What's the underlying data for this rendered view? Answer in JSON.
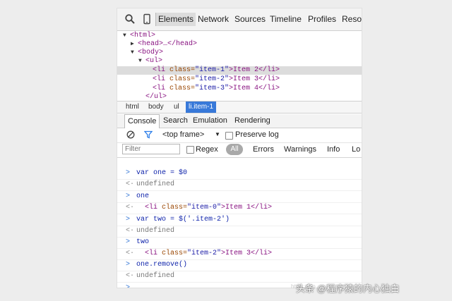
{
  "tabs": {
    "items": [
      "Elements",
      "Network",
      "Sources",
      "Timeline",
      "Profiles",
      "Resou"
    ],
    "active": "Elements"
  },
  "dom_tree": {
    "html_open": "<html>",
    "head": "<head>…</head>",
    "body_open": "<body>",
    "ul_open": "<ul>",
    "li1_open": "<li ",
    "li1_attr": "class=",
    "li1_val": "\"item-1\"",
    "li1_text": ">Item 2</li>",
    "li2_open": "<li ",
    "li2_attr": "class=",
    "li2_val": "\"item-2\"",
    "li2_text": ">Item 3</li>",
    "li3_open": "<li ",
    "li3_attr": "class=",
    "li3_val": "\"item-3\"",
    "li3_text": ">Item 4</li>",
    "ul_close": "</ul>"
  },
  "breadcrumbs": [
    "html",
    "body",
    "ul",
    "li.item-1"
  ],
  "drawer_tabs": [
    "Console",
    "Search",
    "Emulation",
    "Rendering"
  ],
  "toolbar": {
    "frame": "<top frame>",
    "frame_arrow": "▼",
    "preserve_log": "Preserve log"
  },
  "filter": {
    "placeholder": "Filter",
    "regex": "Regex",
    "all": "All",
    "levels": [
      "Errors",
      "Warnings",
      "Info",
      "Lo"
    ]
  },
  "console": {
    "m1": "var one = $0",
    "m2": "undefined",
    "m3": "one",
    "m4_tag": "<li ",
    "m4_attr": "class=",
    "m4_val": "\"item-0\"",
    "m4_text": ">Item 1</li>",
    "m5": "var two = $('.item-2')",
    "m6": "undefined",
    "m7": "two",
    "m8_tag": "<li ",
    "m8_attr": "class=",
    "m8_val": "\"item-2\"",
    "m8_text": ">Item 3</li>",
    "m9": "one.remove()",
    "m10": "undefined",
    "prompt": ">"
  },
  "watermark": {
    "text": "头条 @程序猿的内心独白",
    "small": "https://blo"
  },
  "colors": {
    "tag": "#881280",
    "attr": "#994500",
    "value": "#1a1aa6",
    "selection": "#3879d9"
  }
}
